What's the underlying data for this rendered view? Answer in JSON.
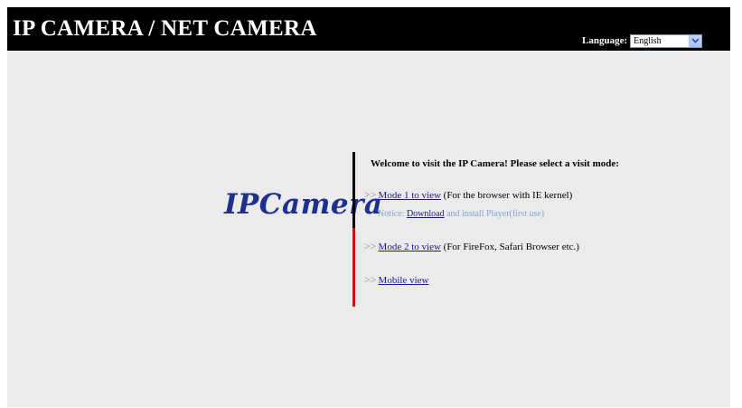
{
  "header": {
    "title": "IP CAMERA / NET CAMERA",
    "language_label": "Language:",
    "language_selected": "English"
  },
  "logo": {
    "text": "IPCamera"
  },
  "main": {
    "welcome": "Welcome to visit the IP Camera! Please select a visit mode:",
    "arrow_glyph": ">>",
    "mode1": {
      "link": "Mode 1 to view",
      "desc": " (For the browser with IE kernel)"
    },
    "notice": {
      "prefix": "Notice: ",
      "link": "Download",
      "suffix": " and install Player(first use)"
    },
    "mode2": {
      "link": "Mode 2 to view",
      "desc": " (For FireFox, Safari Browser etc.)"
    },
    "mobile": {
      "link": "Mobile view"
    }
  },
  "colors": {
    "header_bg": "#000000",
    "page_bg": "#ebebeb",
    "logo": "#1e2f8c",
    "link": "#1a1a8c",
    "divider_top": "#000000",
    "divider_bottom": "#d01010",
    "notice": "#7fa7d6"
  }
}
